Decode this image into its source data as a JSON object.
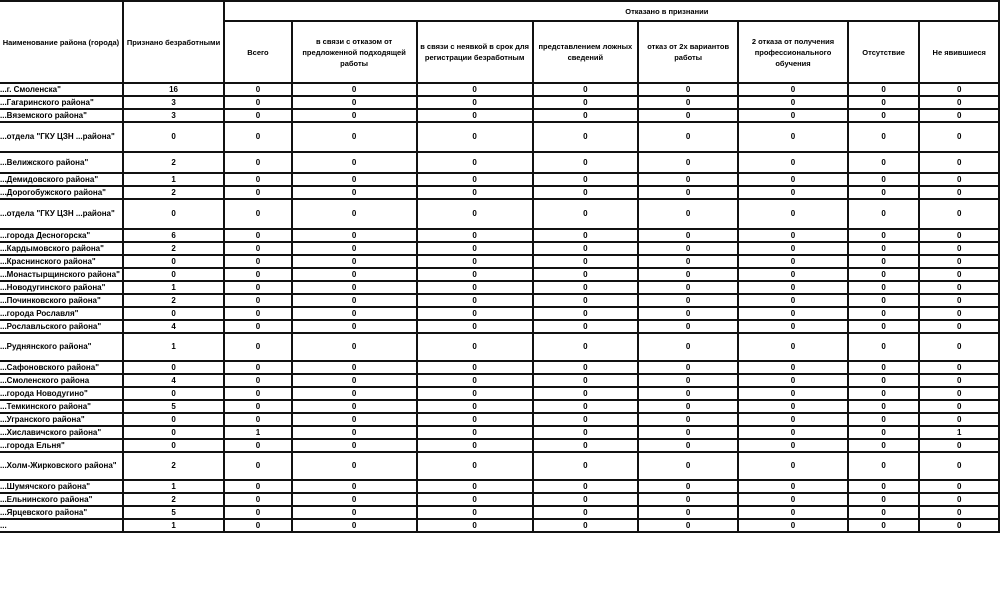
{
  "table": {
    "headers": {
      "district": "Наименование района (города)",
      "recognized": "Признано безработными",
      "group": "Отказано в признании",
      "sub": [
        "Всего",
        "в связи с отказом от предложенной подходящей работы",
        "в связи с неявкой в срок для регистрации безработным",
        "представлением ложных сведений",
        "отказ от 2х вариантов работы",
        "2 отказа от получения профессионального обучения",
        "Отсутствие",
        "Не явившиеся"
      ]
    },
    "rows": [
      {
        "name": "...г. Смоленска\"",
        "recognized": "16",
        "values": [
          "0",
          "0",
          "0",
          "0",
          "0",
          "0",
          "0",
          "0"
        ],
        "h": "short"
      },
      {
        "name": "...Гагаринского района\"",
        "recognized": "3",
        "values": [
          "0",
          "0",
          "0",
          "0",
          "0",
          "0",
          "0",
          "0"
        ],
        "h": "short"
      },
      {
        "name": "...Вяземского района\"",
        "recognized": "3",
        "values": [
          "0",
          "0",
          "0",
          "0",
          "0",
          "0",
          "0",
          "0"
        ],
        "h": "short"
      },
      {
        "name": "...отдела \"ГКУ ЦЗН ...района\"",
        "recognized": "0",
        "values": [
          "0",
          "0",
          "0",
          "0",
          "0",
          "0",
          "0",
          "0"
        ],
        "h": "tall"
      },
      {
        "name": "...Велижского района\"",
        "recognized": "2",
        "values": [
          "0",
          "0",
          "0",
          "0",
          "0",
          "0",
          "0",
          "0"
        ],
        "h": "mid"
      },
      {
        "name": "...Демидовского района\"",
        "recognized": "1",
        "values": [
          "0",
          "0",
          "0",
          "0",
          "0",
          "0",
          "0",
          "0"
        ],
        "h": "short"
      },
      {
        "name": "...Дорогобужского района\"",
        "recognized": "2",
        "values": [
          "0",
          "0",
          "0",
          "0",
          "0",
          "0",
          "0",
          "0"
        ],
        "h": "short"
      },
      {
        "name": "...отдела \"ГКУ ЦЗН ...района\"",
        "recognized": "0",
        "values": [
          "0",
          "0",
          "0",
          "0",
          "0",
          "0",
          "0",
          "0"
        ],
        "h": "tall"
      },
      {
        "name": "...города Десногорска\"",
        "recognized": "6",
        "values": [
          "0",
          "0",
          "0",
          "0",
          "0",
          "0",
          "0",
          "0"
        ],
        "h": "short"
      },
      {
        "name": "...Кардымовского района\"",
        "recognized": "2",
        "values": [
          "0",
          "0",
          "0",
          "0",
          "0",
          "0",
          "0",
          "0"
        ],
        "h": "short"
      },
      {
        "name": "...Краснинского района\"",
        "recognized": "0",
        "values": [
          "0",
          "0",
          "0",
          "0",
          "0",
          "0",
          "0",
          "0"
        ],
        "h": "short"
      },
      {
        "name": "...Монастырщинского района\"",
        "recognized": "0",
        "values": [
          "0",
          "0",
          "0",
          "0",
          "0",
          "0",
          "0",
          "0"
        ],
        "h": "short"
      },
      {
        "name": "...Новодугинского района\"",
        "recognized": "1",
        "values": [
          "0",
          "0",
          "0",
          "0",
          "0",
          "0",
          "0",
          "0"
        ],
        "h": "short"
      },
      {
        "name": "...Починковского района\"",
        "recognized": "2",
        "values": [
          "0",
          "0",
          "0",
          "0",
          "0",
          "0",
          "0",
          "0"
        ],
        "h": "short"
      },
      {
        "name": "...города Рославля\"",
        "recognized": "0",
        "values": [
          "0",
          "0",
          "0",
          "0",
          "0",
          "0",
          "0",
          "0"
        ],
        "h": "short"
      },
      {
        "name": "...Рославльского района\"",
        "recognized": "4",
        "values": [
          "0",
          "0",
          "0",
          "0",
          "0",
          "0",
          "0",
          "0"
        ],
        "h": "short"
      },
      {
        "name": "...Руднянского района\"",
        "recognized": "1",
        "values": [
          "0",
          "0",
          "0",
          "0",
          "0",
          "0",
          "0",
          "0"
        ],
        "h": "tall2"
      },
      {
        "name": "...Сафоновского района\"",
        "recognized": "0",
        "values": [
          "0",
          "0",
          "0",
          "0",
          "0",
          "0",
          "0",
          "0"
        ],
        "h": "short"
      },
      {
        "name": "...Смоленского района",
        "recognized": "4",
        "values": [
          "0",
          "0",
          "0",
          "0",
          "0",
          "0",
          "0",
          "0"
        ],
        "h": "short"
      },
      {
        "name": "...города Новодугино\"",
        "recognized": "0",
        "values": [
          "0",
          "0",
          "0",
          "0",
          "0",
          "0",
          "0",
          "0"
        ],
        "h": "short"
      },
      {
        "name": "...Темкинского района\"",
        "recognized": "5",
        "values": [
          "0",
          "0",
          "0",
          "0",
          "0",
          "0",
          "0",
          "0"
        ],
        "h": "short"
      },
      {
        "name": "...Угранского района\"",
        "recognized": "0",
        "values": [
          "0",
          "0",
          "0",
          "0",
          "0",
          "0",
          "0",
          "0"
        ],
        "h": "short"
      },
      {
        "name": "...Хиславичского района\"",
        "recognized": "0",
        "values": [
          "1",
          "0",
          "0",
          "0",
          "0",
          "0",
          "0",
          "1"
        ],
        "h": "short"
      },
      {
        "name": "...города Ельня\"",
        "recognized": "0",
        "values": [
          "0",
          "0",
          "0",
          "0",
          "0",
          "0",
          "0",
          "0"
        ],
        "h": "short"
      },
      {
        "name": "...Холм-Жирковского района\"",
        "recognized": "2",
        "values": [
          "0",
          "0",
          "0",
          "0",
          "0",
          "0",
          "0",
          "0"
        ],
        "h": "tall2"
      },
      {
        "name": "...Шумячского района\"",
        "recognized": "1",
        "values": [
          "0",
          "0",
          "0",
          "0",
          "0",
          "0",
          "0",
          "0"
        ],
        "h": "short"
      },
      {
        "name": "...Ельнинского района\"",
        "recognized": "2",
        "values": [
          "0",
          "0",
          "0",
          "0",
          "0",
          "0",
          "0",
          "0"
        ],
        "h": "short"
      },
      {
        "name": "...Ярцевского района\"",
        "recognized": "5",
        "values": [
          "0",
          "0",
          "0",
          "0",
          "0",
          "0",
          "0",
          "0"
        ],
        "h": "short"
      },
      {
        "name": "...",
        "recognized": "1",
        "values": [
          "0",
          "0",
          "0",
          "0",
          "0",
          "0",
          "0",
          "0"
        ],
        "h": "short"
      }
    ]
  }
}
